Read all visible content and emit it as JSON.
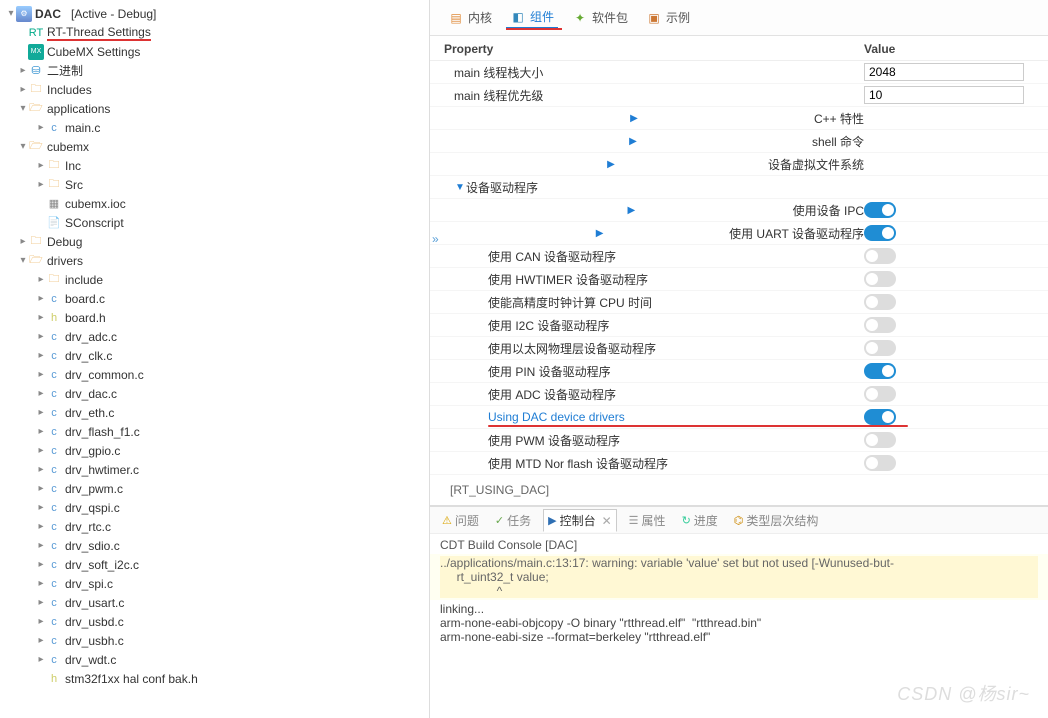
{
  "project": {
    "name": "DAC",
    "state": "[Active - Debug]"
  },
  "tree": {
    "rt_thread_settings": "RT-Thread Settings",
    "cubemx_settings": "CubeMX Settings",
    "binary": "二进制",
    "includes": "Includes",
    "applications": "applications",
    "main_c": "main.c",
    "cubemx": "cubemx",
    "inc": "Inc",
    "src": "Src",
    "cubemx_ioc": "cubemx.ioc",
    "sconscript": "SConscript",
    "debug": "Debug",
    "drivers": "drivers",
    "d": {
      "include": "include",
      "board_c": "board.c",
      "board_h": "board.h",
      "drv_adc": "drv_adc.c",
      "drv_clk": "drv_clk.c",
      "drv_common": "drv_common.c",
      "drv_dac": "drv_dac.c",
      "drv_eth": "drv_eth.c",
      "drv_flash_f1": "drv_flash_f1.c",
      "drv_gpio": "drv_gpio.c",
      "drv_hwtimer": "drv_hwtimer.c",
      "drv_pwm": "drv_pwm.c",
      "drv_qspi": "drv_qspi.c",
      "drv_rtc": "drv_rtc.c",
      "drv_sdio": "drv_sdio.c",
      "drv_soft_i2c": "drv_soft_i2c.c",
      "drv_spi": "drv_spi.c",
      "drv_usart": "drv_usart.c",
      "drv_usbd": "drv_usbd.c",
      "drv_usbh": "drv_usbh.c",
      "drv_wdt": "drv_wdt.c",
      "stm32_bak": "stm32f1xx hal conf bak.h"
    }
  },
  "tabs": {
    "kernel": "内核",
    "component": "组件",
    "packages": "软件包",
    "example": "示例"
  },
  "columns": {
    "property": "Property",
    "value": "Value"
  },
  "props": {
    "main_stack": {
      "label": "main 线程栈大小",
      "value": "2048"
    },
    "main_prio": {
      "label": "main 线程优先级",
      "value": "10"
    },
    "cpp": "C++ 特性",
    "shell": "shell 命令",
    "vfs": "设备虚拟文件系统",
    "drv": "设备驱动程序",
    "ipc": {
      "label": "使用设备 IPC",
      "on": true
    },
    "uart": {
      "label": "使用 UART 设备驱动程序",
      "on": true
    },
    "can": {
      "label": "使用 CAN 设备驱动程序",
      "on": false
    },
    "hwt": {
      "label": "使用 HWTIMER 设备驱动程序",
      "on": false
    },
    "cputime": {
      "label": "使能高精度时钟计算 CPU 时间",
      "on": false
    },
    "i2c": {
      "label": "使用 I2C 设备驱动程序",
      "on": false
    },
    "eth": {
      "label": "使用以太网物理层设备驱动程序",
      "on": false
    },
    "pin": {
      "label": "使用 PIN 设备驱动程序",
      "on": true
    },
    "adc": {
      "label": "使用 ADC 设备驱动程序",
      "on": false
    },
    "dac": {
      "label": "Using DAC device drivers",
      "on": true
    },
    "pwm": {
      "label": "使用 PWM 设备驱动程序",
      "on": false
    },
    "mtd": {
      "label": "使用 MTD Nor flash 设备驱动程序",
      "on": false
    }
  },
  "status_macro": "[RT_USING_DAC]",
  "console": {
    "tabs": {
      "problems": "问题",
      "tasks": "任务",
      "console": "控制台",
      "properties": "属性",
      "progress": "进度",
      "typeh": "类型层次结构"
    },
    "title": "CDT Build Console [DAC]",
    "warn1": "../applications/main.c:13:17: warning: variable 'value' set but not used [-Wunused-but-",
    "warn2": "     rt_uint32_t value;",
    "warn3": "                 ^",
    "line1": "linking...",
    "line2": "arm-none-eabi-objcopy -O binary \"rtthread.elf\"  \"rtthread.bin\"",
    "line3": "arm-none-eabi-size --format=berkeley \"rtthread.elf\""
  },
  "watermark": "CSDN @杨sir~"
}
